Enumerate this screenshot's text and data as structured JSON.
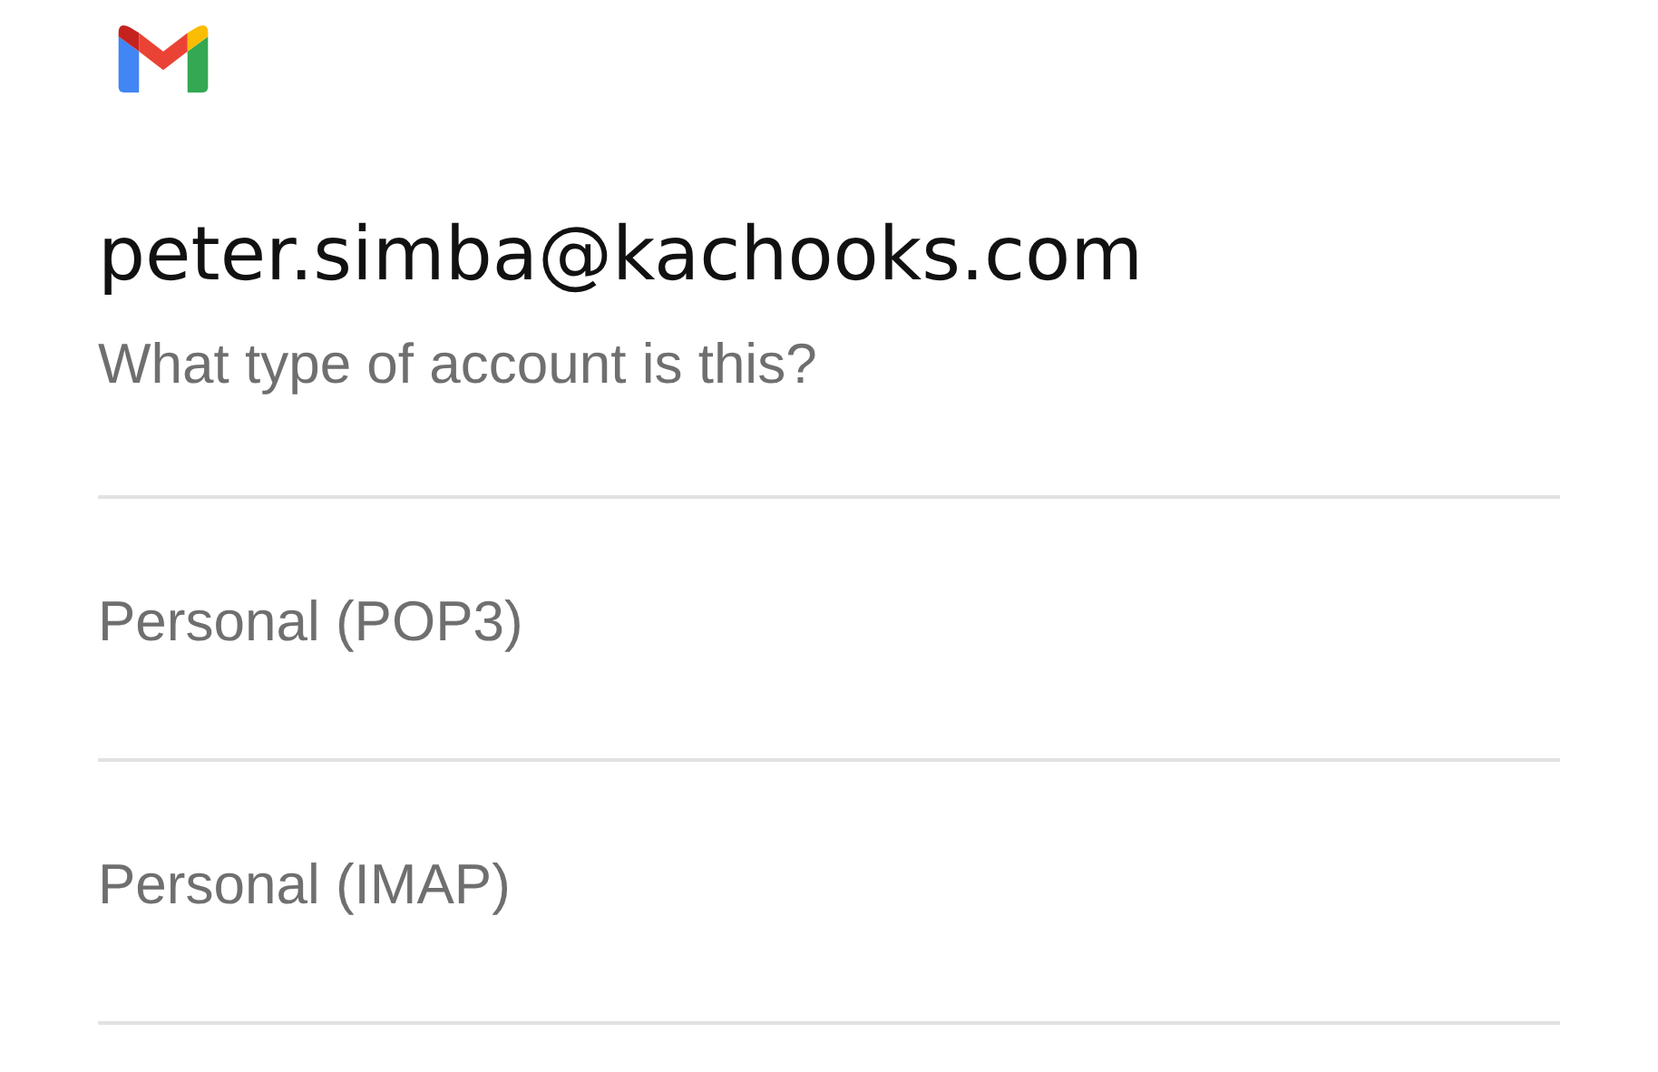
{
  "account": {
    "email": "peter.simba@kachooks.com",
    "prompt": "What type of account is this?"
  },
  "options": [
    {
      "label": "Personal (POP3)"
    },
    {
      "label": "Personal (IMAP)"
    }
  ]
}
